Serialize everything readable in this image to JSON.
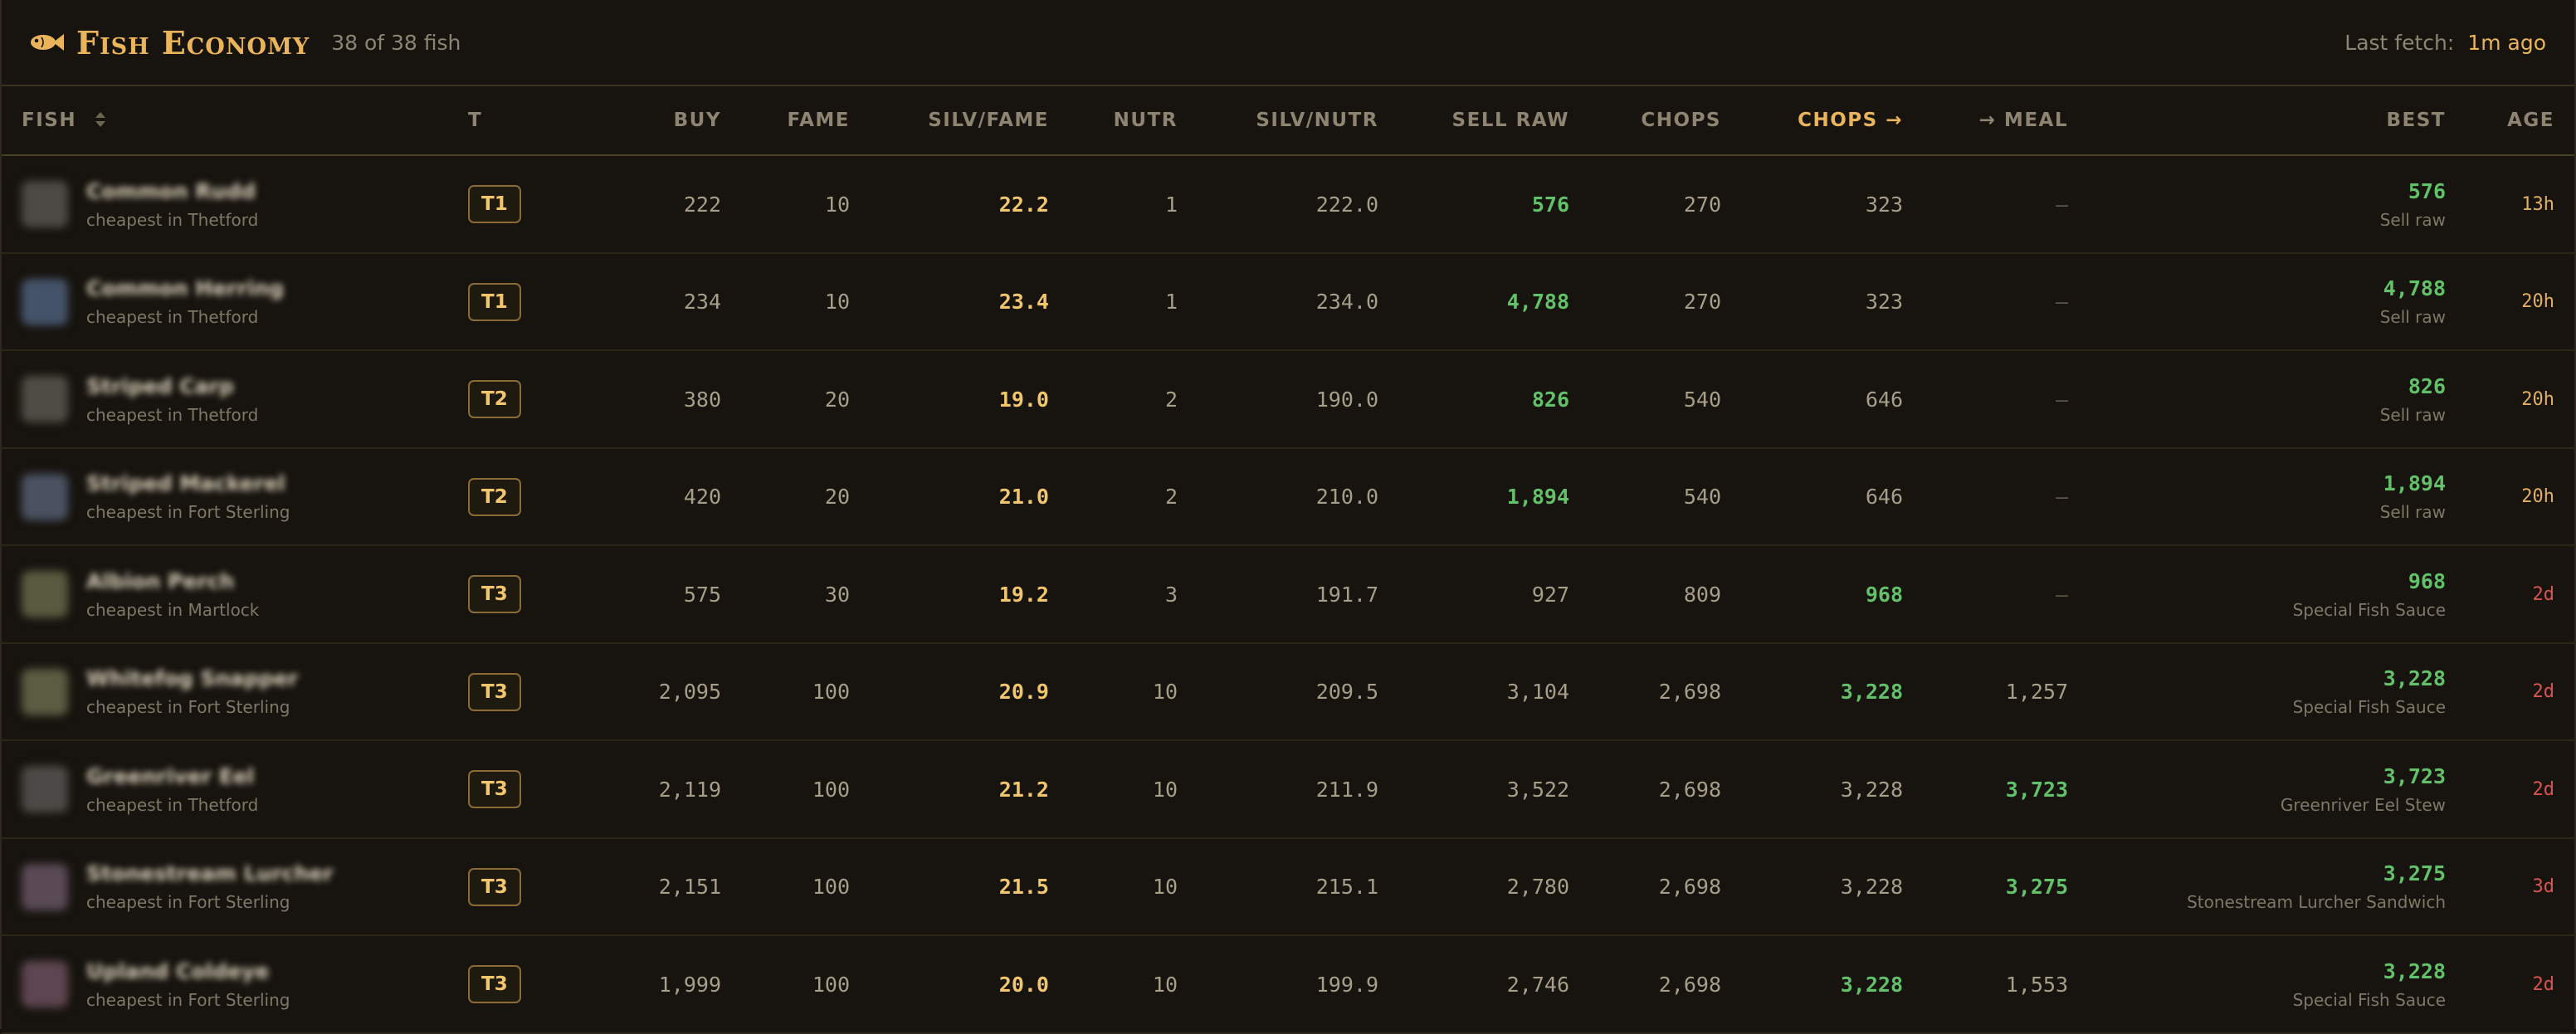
{
  "header": {
    "title": "Fish Economy",
    "count": "38 of 38 fish",
    "last_fetch_label": "Last fetch:",
    "last_fetch_value": "1m ago",
    "icon": "fish-icon",
    "accent": "#e9b45a"
  },
  "columns": {
    "fish": "FISH",
    "tier": "T",
    "buy": "BUY",
    "fame": "FAME",
    "silv_fame": "SILV/FAME",
    "nutr": "NUTR",
    "silv_nutr": "SILV/NUTR",
    "sell_raw": "SELL RAW",
    "chops": "CHOPS",
    "chops_to": "CHOPS →",
    "to_meal": "→ MEAL",
    "best": "BEST",
    "age": "AGE",
    "sort_icon": "sort-icon"
  },
  "colors": {
    "green": "#63c16a",
    "yellow": "#f2c66d",
    "age_recent": "#e0b060",
    "age_old": "#d9534f"
  },
  "rows": [
    {
      "name": "Common Rudd",
      "sub": "cheapest in Thetford",
      "tier": "T1",
      "buy": "222",
      "fame": "10",
      "silv_fame": "22.2",
      "nutr": "1",
      "silv_nutr": "222.0",
      "sell_raw": "576",
      "chops": "270",
      "chops_to": "323",
      "meal": "—",
      "best_value": "576",
      "best_label": "Sell raw",
      "age": "13h",
      "best_col": "sell_raw",
      "thumb_color": "#4b4a45"
    },
    {
      "name": "Common Herring",
      "sub": "cheapest in Thetford",
      "tier": "T1",
      "buy": "234",
      "fame": "10",
      "silv_fame": "23.4",
      "nutr": "1",
      "silv_nutr": "234.0",
      "sell_raw": "4,788",
      "chops": "270",
      "chops_to": "323",
      "meal": "—",
      "best_value": "4,788",
      "best_label": "Sell raw",
      "age": "20h",
      "best_col": "sell_raw",
      "thumb_color": "#45536a"
    },
    {
      "name": "Striped Carp",
      "sub": "cheapest in Thetford",
      "tier": "T2",
      "buy": "380",
      "fame": "20",
      "silv_fame": "19.0",
      "nutr": "2",
      "silv_nutr": "190.0",
      "sell_raw": "826",
      "chops": "540",
      "chops_to": "646",
      "meal": "—",
      "best_value": "826",
      "best_label": "Sell raw",
      "age": "20h",
      "best_col": "sell_raw",
      "thumb_color": "#4e4c43"
    },
    {
      "name": "Striped Mackerel",
      "sub": "cheapest in Fort Sterling",
      "tier": "T2",
      "buy": "420",
      "fame": "20",
      "silv_fame": "21.0",
      "nutr": "2",
      "silv_nutr": "210.0",
      "sell_raw": "1,894",
      "chops": "540",
      "chops_to": "646",
      "meal": "—",
      "best_value": "1,894",
      "best_label": "Sell raw",
      "age": "20h",
      "best_col": "sell_raw",
      "thumb_color": "#4a5262"
    },
    {
      "name": "Albion Perch",
      "sub": "cheapest in Martlock",
      "tier": "T3",
      "buy": "575",
      "fame": "30",
      "silv_fame": "19.2",
      "nutr": "3",
      "silv_nutr": "191.7",
      "sell_raw": "927",
      "chops": "809",
      "chops_to": "968",
      "meal": "—",
      "best_value": "968",
      "best_label": "Special Fish Sauce",
      "age": "2d",
      "best_col": "chops_to",
      "thumb_color": "#5a5a40"
    },
    {
      "name": "Whitefog Snapper",
      "sub": "cheapest in Fort Sterling",
      "tier": "T3",
      "buy": "2,095",
      "fame": "100",
      "silv_fame": "20.9",
      "nutr": "10",
      "silv_nutr": "209.5",
      "sell_raw": "3,104",
      "chops": "2,698",
      "chops_to": "3,228",
      "meal": "1,257",
      "best_value": "3,228",
      "best_label": "Special Fish Sauce",
      "age": "2d",
      "best_col": "chops_to",
      "thumb_color": "#5b5c42"
    },
    {
      "name": "Greenriver Eel",
      "sub": "cheapest in Thetford",
      "tier": "T3",
      "buy": "2,119",
      "fame": "100",
      "silv_fame": "21.2",
      "nutr": "10",
      "silv_nutr": "211.9",
      "sell_raw": "3,522",
      "chops": "2,698",
      "chops_to": "3,228",
      "meal": "3,723",
      "best_value": "3,723",
      "best_label": "Greenriver Eel Stew",
      "age": "2d",
      "best_col": "meal",
      "thumb_color": "#4c4a46"
    },
    {
      "name": "Stonestream Lurcher",
      "sub": "cheapest in Fort Sterling",
      "tier": "T3",
      "buy": "2,151",
      "fame": "100",
      "silv_fame": "21.5",
      "nutr": "10",
      "silv_nutr": "215.1",
      "sell_raw": "2,780",
      "chops": "2,698",
      "chops_to": "3,228",
      "meal": "3,275",
      "best_value": "3,275",
      "best_label": "Stonestream Lurcher Sandwich",
      "age": "3d",
      "best_col": "meal",
      "thumb_color": "#5a4a55"
    },
    {
      "name": "Upland Coldeye",
      "sub": "cheapest in Fort Sterling",
      "tier": "T3",
      "buy": "1,999",
      "fame": "100",
      "silv_fame": "20.0",
      "nutr": "10",
      "silv_nutr": "199.9",
      "sell_raw": "2,746",
      "chops": "2,698",
      "chops_to": "3,228",
      "meal": "1,553",
      "best_value": "3,228",
      "best_label": "Special Fish Sauce",
      "age": "2d",
      "best_col": "chops_to",
      "thumb_color": "#5e4650"
    }
  ]
}
